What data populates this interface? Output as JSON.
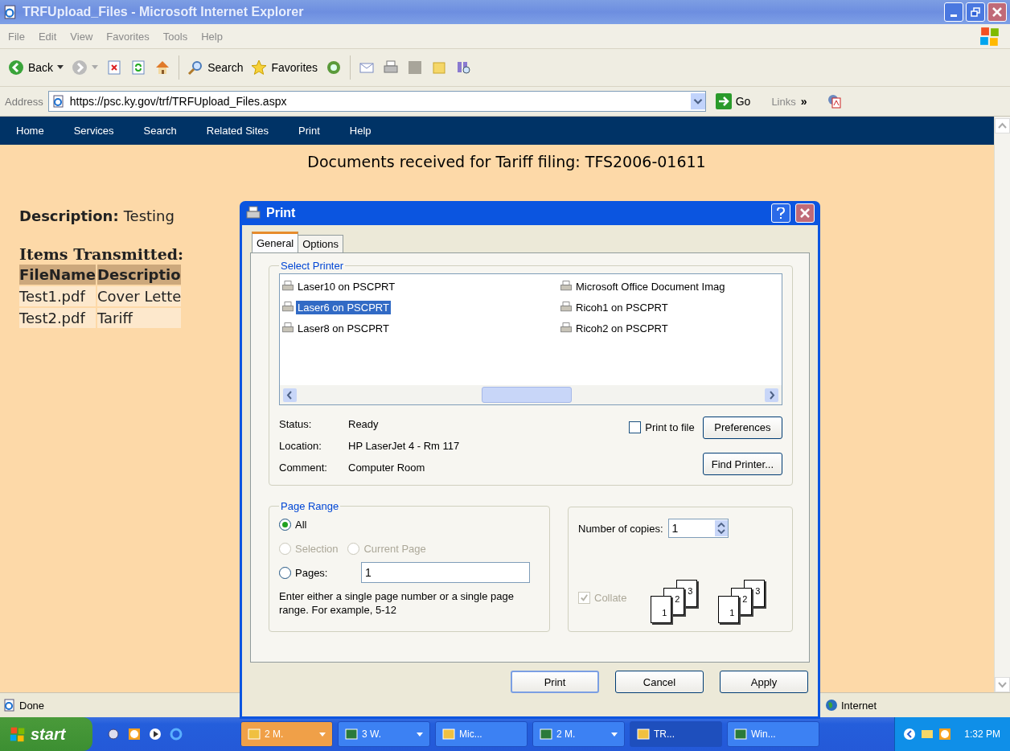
{
  "window": {
    "title": "TRFUpload_Files - Microsoft Internet Explorer"
  },
  "menu": [
    "File",
    "Edit",
    "View",
    "Favorites",
    "Tools",
    "Help"
  ],
  "toolbar": {
    "back": "Back",
    "search": "Search",
    "favorites": "Favorites"
  },
  "address": {
    "label": "Address",
    "value": "https://psc.ky.gov/trf/TRFUpload_Files.aspx",
    "go": "Go",
    "links": "Links",
    "more": "»"
  },
  "nav": [
    "Home",
    "Services",
    "Search",
    "Related Sites",
    "Print",
    "Help"
  ],
  "page": {
    "heading": "Documents received for Tariff filing: TFS2006-01611",
    "description_label": "Description:",
    "description": "Testing",
    "items_heading": "Items Transmitted:",
    "columns": [
      "FileName",
      "Descriptio"
    ],
    "rows": [
      [
        "Test1.pdf",
        "Cover Lette"
      ],
      [
        "Test2.pdf",
        "Tariff"
      ]
    ]
  },
  "status_bar": {
    "text": "Done",
    "zone": "Internet"
  },
  "dialog": {
    "title": "Print",
    "tabs": [
      {
        "label": "General",
        "selected": true
      },
      {
        "label": "Options",
        "selected": false
      }
    ],
    "printer_group": "Select Printer",
    "printers": [
      {
        "name": "Laser10 on PSCPRT",
        "selected": false
      },
      {
        "name": "Laser6 on PSCPRT",
        "selected": true
      },
      {
        "name": "Laser8 on PSCPRT",
        "selected": false
      },
      {
        "name": "Microsoft Office Document Imag",
        "selected": false
      },
      {
        "name": "Ricoh1 on PSCPRT",
        "selected": false
      },
      {
        "name": "Ricoh2 on PSCPRT",
        "selected": false
      }
    ],
    "info": [
      {
        "label": "Status:",
        "value": "Ready"
      },
      {
        "label": "Location:",
        "value": "HP LaserJet 4 - Rm 117"
      },
      {
        "label": "Comment:",
        "value": "Computer Room"
      }
    ],
    "print_to_file": {
      "label": "Print to file",
      "checked": false
    },
    "preferences": "Preferences",
    "find_printer": "Find Printer...",
    "range_group": "Page Range",
    "range_options": [
      {
        "label": "All",
        "selected": true,
        "disabled": false
      },
      {
        "label": "Selection",
        "selected": false,
        "disabled": true
      },
      {
        "label": "Current Page",
        "selected": false,
        "disabled": true
      },
      {
        "label": "Pages:",
        "selected": false,
        "disabled": false
      }
    ],
    "pages_value": "1",
    "range_hint": "Enter either a single page number or a single page range.  For example, 5-12",
    "copies_label": "Number of copies:",
    "copies": "1",
    "collate": {
      "label": "Collate",
      "checked": true,
      "disabled": true
    },
    "collate_stacks": [
      [
        "1",
        "2",
        "3"
      ],
      [
        "1",
        "2",
        "3"
      ]
    ],
    "buttons": [
      "Print",
      "Cancel",
      "Apply"
    ]
  },
  "taskbar": {
    "start": "start",
    "tasks": [
      {
        "label": "2 M.",
        "selected": false,
        "flashing": true,
        "menu": true
      },
      {
        "label": "3 W.",
        "selected": false,
        "flashing": false,
        "menu": true
      },
      {
        "label": "Mic...",
        "selected": false,
        "flashing": false,
        "menu": false
      },
      {
        "label": "2 M.",
        "selected": false,
        "flashing": false,
        "menu": true
      },
      {
        "label": "TR...",
        "selected": true,
        "flashing": false,
        "menu": false
      },
      {
        "label": "Win...",
        "selected": false,
        "flashing": false,
        "menu": false
      }
    ],
    "clock": "1:32 PM"
  }
}
